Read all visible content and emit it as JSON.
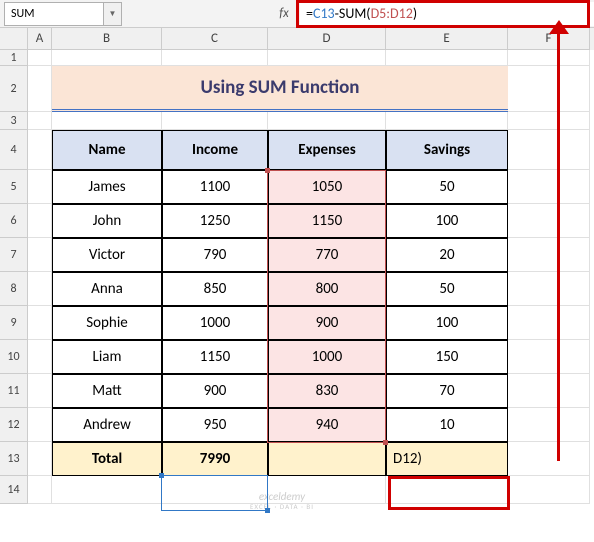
{
  "namebox": "SUM",
  "fx_label": "fx",
  "formula": {
    "eq": "=",
    "ref1": "C13",
    "minus": "-SUM(",
    "range": "D5:D12",
    "close": ")"
  },
  "columns": [
    "A",
    "B",
    "C",
    "D",
    "E",
    "F"
  ],
  "row_numbers": [
    "1",
    "2",
    "3",
    "4",
    "5",
    "6",
    "7",
    "8",
    "9",
    "10",
    "11",
    "12",
    "13",
    "14"
  ],
  "title": "Using SUM Function",
  "headers": {
    "name": "Name",
    "income": "Income",
    "expenses": "Expenses",
    "savings": "Savings"
  },
  "data": [
    {
      "name": "James",
      "income": "1100",
      "expenses": "1050",
      "savings": "50"
    },
    {
      "name": "John",
      "income": "1250",
      "expenses": "1150",
      "savings": "100"
    },
    {
      "name": "Victor",
      "income": "790",
      "expenses": "770",
      "savings": "20"
    },
    {
      "name": "Anna",
      "income": "850",
      "expenses": "800",
      "savings": "50"
    },
    {
      "name": "Sophie",
      "income": "1000",
      "expenses": "900",
      "savings": "100"
    },
    {
      "name": "Liam",
      "income": "1150",
      "expenses": "1000",
      "savings": "150"
    },
    {
      "name": "Matt",
      "income": "900",
      "expenses": "830",
      "savings": "70"
    },
    {
      "name": "Andrew",
      "income": "950",
      "expenses": "940",
      "savings": "10"
    }
  ],
  "total": {
    "label": "Total",
    "income": "7990",
    "expenses": "",
    "savings_editing": "D12)"
  },
  "watermark": {
    "line1": "exceldemy",
    "line2": "EXCEL · DATA · BI"
  },
  "chart_data": {
    "type": "table",
    "title": "Using SUM Function",
    "columns": [
      "Name",
      "Income",
      "Expenses",
      "Savings"
    ],
    "rows": [
      [
        "James",
        1100,
        1050,
        50
      ],
      [
        "John",
        1250,
        1150,
        100
      ],
      [
        "Victor",
        790,
        770,
        20
      ],
      [
        "Anna",
        850,
        800,
        50
      ],
      [
        "Sophie",
        1000,
        900,
        100
      ],
      [
        "Liam",
        1150,
        1000,
        150
      ],
      [
        "Matt",
        900,
        830,
        70
      ],
      [
        "Andrew",
        950,
        940,
        10
      ]
    ],
    "totals": {
      "Income": 7990
    }
  }
}
